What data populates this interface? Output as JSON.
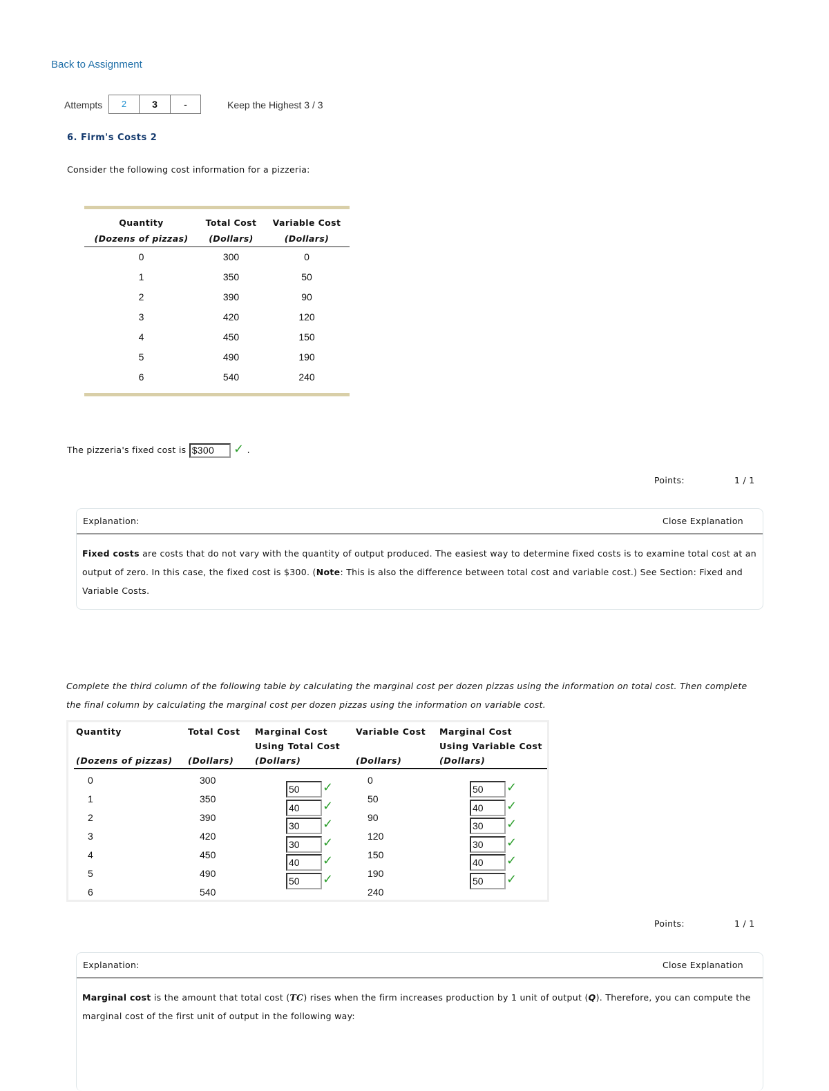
{
  "nav": {
    "back_link": "Back to Assignment"
  },
  "attempts": {
    "label": "Attempts",
    "boxes": [
      "2",
      "3",
      "-"
    ],
    "keep_label": "Keep the Highest 3 / 3"
  },
  "question": {
    "title": "6. Firm's Costs 2",
    "intro": "Consider the following cost information for a pizzeria:",
    "table1": {
      "headers": [
        "Quantity",
        "Total Cost",
        "Variable Cost"
      ],
      "units": [
        "(Dozens of pizzas)",
        "(Dollars)",
        "(Dollars)"
      ],
      "rows": [
        [
          "0",
          "300",
          "0"
        ],
        [
          "1",
          "350",
          "50"
        ],
        [
          "2",
          "390",
          "90"
        ],
        [
          "3",
          "420",
          "120"
        ],
        [
          "4",
          "450",
          "150"
        ],
        [
          "5",
          "490",
          "190"
        ],
        [
          "6",
          "540",
          "240"
        ]
      ]
    },
    "part1": {
      "prompt_before": "The pizzeria's fixed cost is",
      "answer": "$300",
      "prompt_after": ".",
      "status": "correct",
      "points_label": "Points:",
      "points_value": "1 / 1",
      "explanation": {
        "label": "Explanation:",
        "close_label": "Close Explanation",
        "term": "Fixed costs",
        "text_a": " are costs that do not vary with the quantity of output produced. The easiest way to determine fixed costs is to examine total cost at an output of zero. In this case, the fixed cost is $300. (",
        "note_label": "Note",
        "text_b": ": This is also the difference between total cost and variable cost.) See Section: Fixed and Variable Costs."
      }
    },
    "part2": {
      "instructions": "Complete the third column of the following table by calculating the marginal cost per dozen pizzas using the information on total cost. Then complete the final column by calculating the marginal cost per dozen pizzas using the information on variable cost.",
      "headers": {
        "quantity": "Quantity",
        "total_cost": "Total Cost",
        "mc_total_1": "Marginal Cost",
        "mc_total_2": "Using Total Cost",
        "variable_cost": "Variable Cost",
        "mc_var_1": "Marginal Cost",
        "mc_var_2": "Using Variable Cost"
      },
      "units": {
        "quantity": "(Dozens of pizzas)",
        "total_cost": "(Dollars)",
        "mc_total": "(Dollars)",
        "variable_cost": "(Dollars)",
        "mc_var": "(Dollars)"
      },
      "quantity": [
        "0",
        "1",
        "2",
        "3",
        "4",
        "5",
        "6"
      ],
      "total_cost": [
        "300",
        "350",
        "390",
        "420",
        "450",
        "490",
        "540"
      ],
      "variable_cost": [
        "0",
        "50",
        "90",
        "120",
        "150",
        "190",
        "240"
      ],
      "mc_total_answers": [
        "50",
        "40",
        "30",
        "30",
        "40",
        "50"
      ],
      "mc_var_answers": [
        "50",
        "40",
        "30",
        "30",
        "40",
        "50"
      ],
      "all_correct": true,
      "points_label": "Points:",
      "points_value": "1 / 1",
      "explanation": {
        "label": "Explanation:",
        "close_label": "Close Explanation",
        "term": "Marginal cost",
        "text_a": " is the amount that total cost (",
        "tc_symbol": "TC",
        "text_b": ") rises when the firm increases production by 1 unit of output (",
        "q_symbol": "Q",
        "text_c": "). Therefore, you can compute the marginal cost of the first unit of output in the following way:"
      }
    }
  },
  "colors": {
    "link": "#1f6fa8",
    "title": "#143a6e",
    "table_bar": "#d9cfa8",
    "check": "#2a9d2a"
  }
}
